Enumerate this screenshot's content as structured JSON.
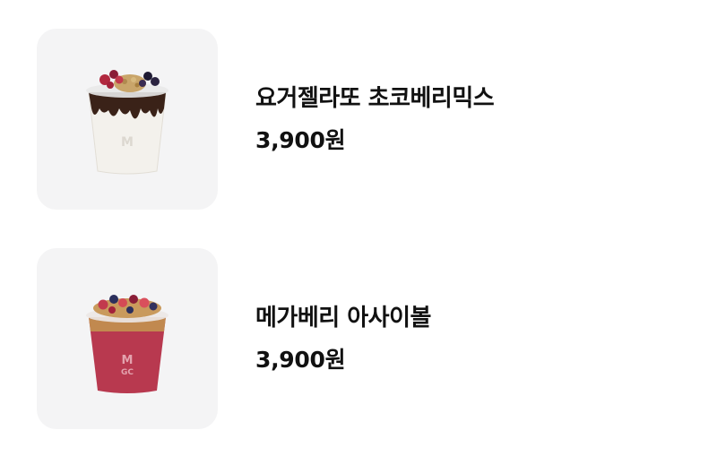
{
  "menu": {
    "items": [
      {
        "name": "요거젤라또 초코베리믹스",
        "price": "3,900원",
        "image": "yogurt-gelato-choco-berry-cup-image"
      },
      {
        "name": "메가베리 아사이볼",
        "price": "3,900원",
        "image": "megaberry-acai-bowl-cup-image"
      }
    ]
  },
  "colors": {
    "thumb_background": "#f4f4f5",
    "text": "#111111",
    "yogurt": "#f3f1ec",
    "chocolate": "#3a2218",
    "acai": "#b8394f"
  }
}
